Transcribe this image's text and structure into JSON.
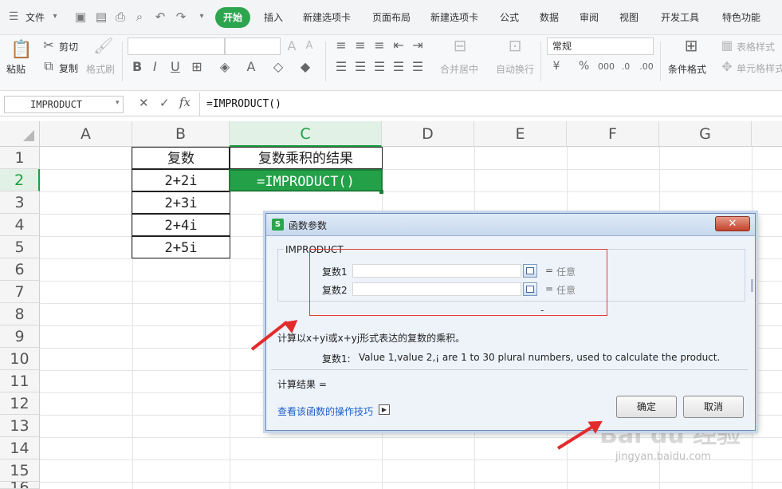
{
  "menubar": {
    "file_label": "文件",
    "tabs": [
      "开始",
      "插入",
      "新建选项卡",
      "页面布局",
      "新建选项卡",
      "公式",
      "数据",
      "审阅",
      "视图",
      "开发工具",
      "特色功能"
    ],
    "active_tab": "开始"
  },
  "ribbon": {
    "paste": "粘贴",
    "cut": "剪切",
    "copy": "复制",
    "format_painter": "格式刷",
    "bold": "B",
    "italic": "I",
    "underline": "U",
    "merge_center": "合并居中",
    "wrap_text": "自动换行",
    "number_format": "常规",
    "percent": "%",
    "conditional_format": "条件格式",
    "table_style": "表格样式",
    "cell_style": "单元格样式"
  },
  "formula_bar": {
    "name_box": "IMPRODUCT",
    "cancel": "✕",
    "confirm": "✓",
    "fx": "fx",
    "formula": "=IMPRODUCT()"
  },
  "sheet": {
    "columns": [
      "A",
      "B",
      "C",
      "D",
      "E",
      "F",
      "G"
    ],
    "rows": [
      "1",
      "2",
      "3",
      "4",
      "5",
      "6",
      "7",
      "8",
      "9",
      "10",
      "11",
      "12",
      "13",
      "14",
      "15",
      "16"
    ],
    "selected_column": "C",
    "selected_row": "2",
    "b_header": "复数",
    "c_header": "复数乘积的结果",
    "b_values": [
      "2+2i",
      "2+3i",
      "2+4i",
      "2+5i"
    ],
    "c2_value": "=IMPRODUCT()"
  },
  "dialog": {
    "title": "函数参数",
    "function_name": "IMPRODUCT",
    "args": [
      {
        "label": "复数1",
        "eq": "=",
        "result": "任意"
      },
      {
        "label": "复数2",
        "eq": "=",
        "result": "任意"
      }
    ],
    "dash": "-",
    "description": "计算以x+yi或x+yj形式表达的复数的乘积。",
    "arg_help_label": "复数1:",
    "arg_help_text": "Value 1,value 2,¡ are 1 to 30 plural numbers, used to calculate the product.",
    "result_label": "计算结果 =",
    "help_link": "查看该函数的操作技巧",
    "ok": "确定",
    "cancel": "取消"
  },
  "watermark": {
    "brand": "Bai du 经验",
    "url": "jingyan.baidu.com"
  },
  "colors": {
    "accent": "#2da44e",
    "selection": "#1e9e43",
    "annotation": "#e32b2b",
    "link": "#1a5fc9"
  }
}
